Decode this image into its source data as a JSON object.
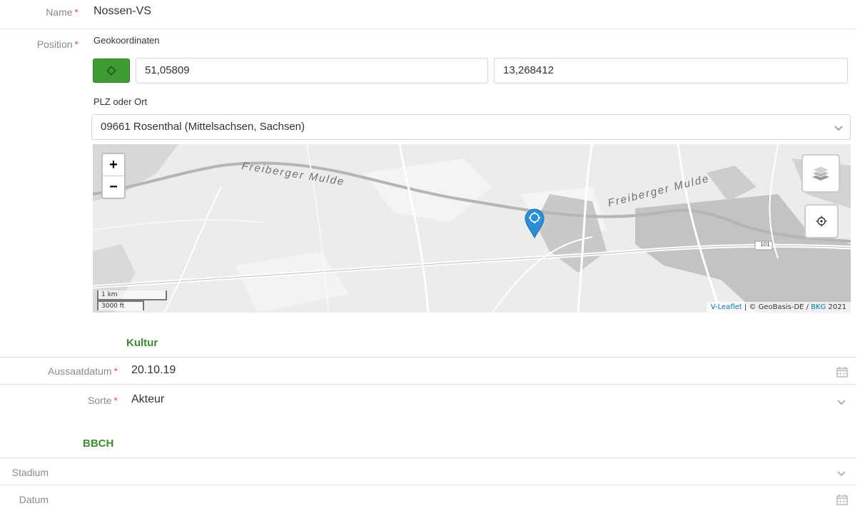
{
  "fields": {
    "name": {
      "label": "Name",
      "required_mark": "*",
      "value": "Nossen-VS"
    },
    "position": {
      "label": "Position",
      "required_mark": "*",
      "geo_label": "Geokoordinaten",
      "lat": "51,05809",
      "lng": "13,268412",
      "plz_label": "PLZ oder Ort",
      "plz_value": "09661 Rosenthal (Mittelsachsen, Sachsen)"
    }
  },
  "map": {
    "zoom_in": "+",
    "zoom_out": "−",
    "labels": [
      "Freiberger Mulde",
      "Freiberger Mulde",
      "101"
    ],
    "scale_km": "1 km",
    "scale_ft": "3000 ft",
    "attribution_link1": "V-Leaflet",
    "attribution_mid": " | © GeoBasis-DE / ",
    "attribution_link2": "BKG",
    "attribution_year": " 2021"
  },
  "kultur": {
    "title": "Kultur",
    "aussaat_label": "Aussaatdatum",
    "aussaat_value": "20.10.19",
    "sorte_label": "Sorte",
    "sorte_value": "Akteur",
    "required_mark": "*"
  },
  "bbch": {
    "title": "BBCH",
    "stadium_label": "Stadium",
    "datum_label": "Datum"
  },
  "colors": {
    "accent_green": "#3f9c35",
    "required_red": "#d9534f",
    "marker_blue": "#2a8fd6"
  }
}
